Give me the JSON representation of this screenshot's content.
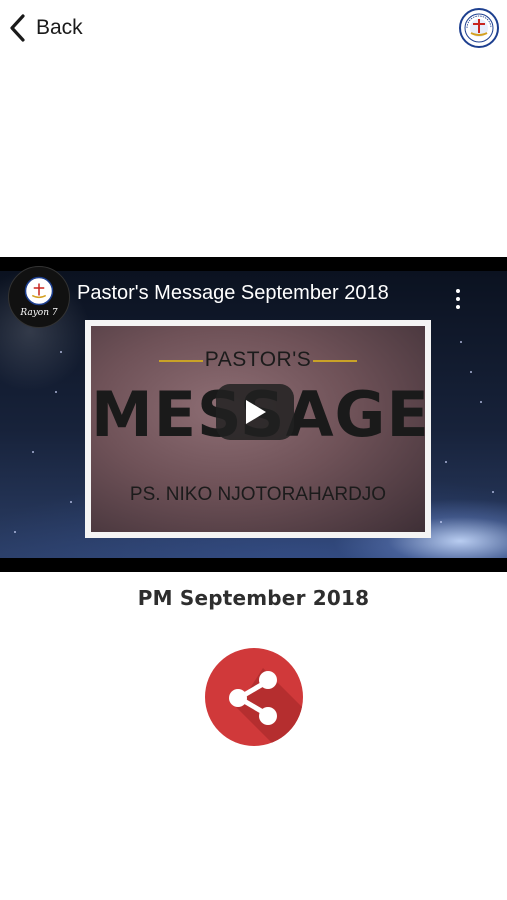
{
  "header": {
    "back_label": "Back",
    "logo_name": "church-logo"
  },
  "video": {
    "title": "Pastor's Message September 2018",
    "channel_name": "Rayon 7",
    "thumbnail": {
      "line1": "PASTOR'S",
      "line2": "MESSAGE",
      "speaker": "PS. NIKO NJOTORAHARDJO"
    }
  },
  "caption": "PM September 2018",
  "colors": {
    "share_red": "#d0393a",
    "text_dark": "#2e2e2e"
  }
}
